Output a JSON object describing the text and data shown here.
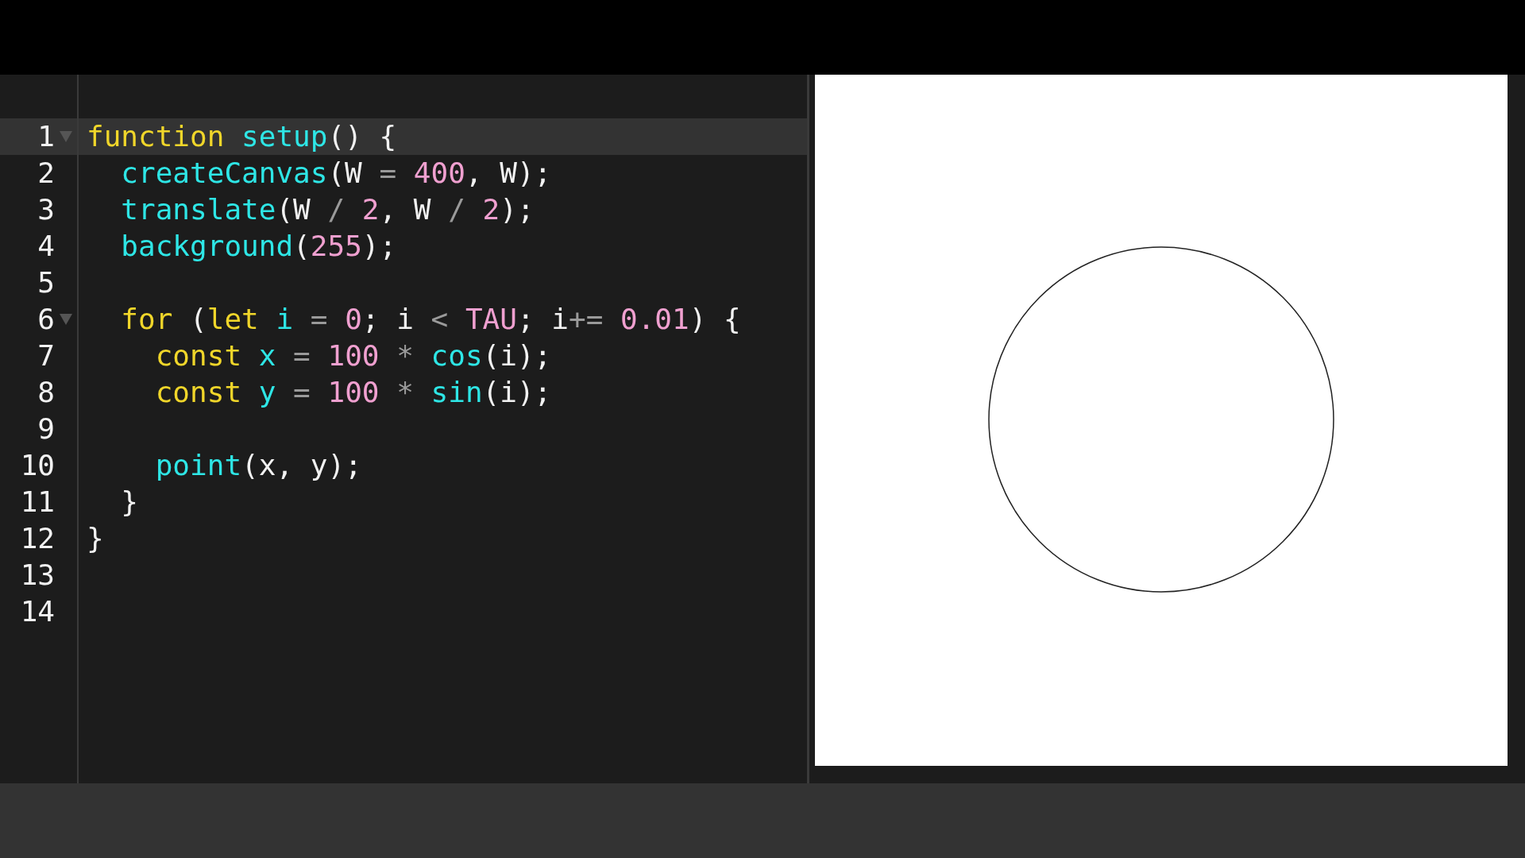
{
  "editor": {
    "lines": [
      {
        "number": "1",
        "active": true,
        "foldable": true,
        "tokens": [
          {
            "kind": "keyword",
            "text": "function "
          },
          {
            "kind": "function",
            "text": "setup"
          },
          {
            "kind": "plain",
            "text": "() {"
          }
        ]
      },
      {
        "number": "2",
        "active": false,
        "foldable": false,
        "tokens": [
          {
            "kind": "function",
            "text": "  createCanvas"
          },
          {
            "kind": "plain",
            "text": "(W "
          },
          {
            "kind": "operator",
            "text": "="
          },
          {
            "kind": "number",
            "text": " 400"
          },
          {
            "kind": "plain",
            "text": ", W);"
          }
        ]
      },
      {
        "number": "3",
        "active": false,
        "foldable": false,
        "tokens": [
          {
            "kind": "function",
            "text": "  translate"
          },
          {
            "kind": "plain",
            "text": "(W "
          },
          {
            "kind": "operator",
            "text": "/"
          },
          {
            "kind": "number",
            "text": " 2"
          },
          {
            "kind": "plain",
            "text": ", W "
          },
          {
            "kind": "operator",
            "text": "/"
          },
          {
            "kind": "number",
            "text": " 2"
          },
          {
            "kind": "plain",
            "text": ");"
          }
        ]
      },
      {
        "number": "4",
        "active": false,
        "foldable": false,
        "tokens": [
          {
            "kind": "function",
            "text": "  background"
          },
          {
            "kind": "plain",
            "text": "("
          },
          {
            "kind": "number",
            "text": "255"
          },
          {
            "kind": "plain",
            "text": ");"
          }
        ]
      },
      {
        "number": "5",
        "active": false,
        "foldable": false
      },
      {
        "number": "6",
        "active": false,
        "foldable": true,
        "tokens": [
          {
            "kind": "keyword",
            "text": "  for"
          },
          {
            "kind": "plain",
            "text": " ("
          },
          {
            "kind": "keyword",
            "text": "let"
          },
          {
            "kind": "variable",
            "text": " i"
          },
          {
            "kind": "operator",
            "text": " ="
          },
          {
            "kind": "number",
            "text": " 0"
          },
          {
            "kind": "plain",
            "text": "; i "
          },
          {
            "kind": "operator",
            "text": "<"
          },
          {
            "kind": "number",
            "text": " TAU"
          },
          {
            "kind": "plain",
            "text": "; i"
          },
          {
            "kind": "operator",
            "text": "+="
          },
          {
            "kind": "number",
            "text": " 0.01"
          },
          {
            "kind": "plain",
            "text": ") {"
          }
        ]
      },
      {
        "number": "7",
        "active": false,
        "foldable": false,
        "tokens": [
          {
            "kind": "keyword",
            "text": "    const"
          },
          {
            "kind": "variable",
            "text": " x"
          },
          {
            "kind": "operator",
            "text": " ="
          },
          {
            "kind": "number",
            "text": " 100"
          },
          {
            "kind": "operator",
            "text": " *"
          },
          {
            "kind": "function",
            "text": " cos"
          },
          {
            "kind": "plain",
            "text": "(i);"
          }
        ]
      },
      {
        "number": "8",
        "active": false,
        "foldable": false,
        "tokens": [
          {
            "kind": "keyword",
            "text": "    const"
          },
          {
            "kind": "variable",
            "text": " y"
          },
          {
            "kind": "operator",
            "text": " ="
          },
          {
            "kind": "number",
            "text": " 100"
          },
          {
            "kind": "operator",
            "text": " *"
          },
          {
            "kind": "function",
            "text": " sin"
          },
          {
            "kind": "plain",
            "text": "(i);"
          }
        ]
      },
      {
        "number": "9",
        "active": false,
        "foldable": false
      },
      {
        "number": "10",
        "active": false,
        "foldable": false,
        "tokens": [
          {
            "kind": "function",
            "text": "    point"
          },
          {
            "kind": "plain",
            "text": "(x, y);"
          }
        ]
      },
      {
        "number": "11",
        "active": false,
        "foldable": false,
        "tokens": [
          {
            "kind": "plain",
            "text": "  }"
          }
        ]
      },
      {
        "number": "12",
        "active": false,
        "foldable": false,
        "tokens": [
          {
            "kind": "plain",
            "text": "}"
          }
        ]
      },
      {
        "number": "13",
        "active": false,
        "foldable": false
      },
      {
        "number": "14",
        "active": false,
        "foldable": false
      }
    ]
  }
}
